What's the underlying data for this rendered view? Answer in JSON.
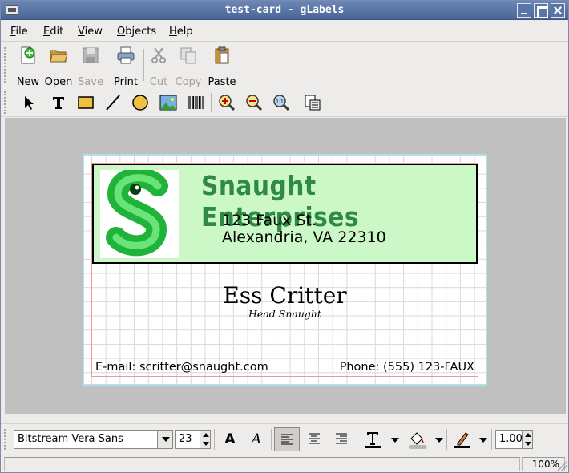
{
  "window": {
    "title": "test-card - gLabels"
  },
  "menu": [
    "File",
    "Edit",
    "View",
    "Objects",
    "Help"
  ],
  "toolbar": {
    "new": "New",
    "open": "Open",
    "save": "Save",
    "print": "Print",
    "cut": "Cut",
    "copy": "Copy",
    "paste": "Paste"
  },
  "label": {
    "company": "Snaught Enterprises",
    "address_line1": "123 Faux St.",
    "address_line2": "Alexandria, VA 22310",
    "name": "Ess Critter",
    "title": "Head Snaught",
    "email": "E-mail: scritter@snaught.com",
    "phone": "Phone: (555) 123-FAUX"
  },
  "fontbar": {
    "font_family": "Bitstream Vera Sans",
    "font_size": "23",
    "line_width": "1.00"
  },
  "status": {
    "zoom": "100%"
  },
  "colors": {
    "banner": "#cbf8c6",
    "company_text": "#2f8a46",
    "logo": "#2fd34a"
  }
}
